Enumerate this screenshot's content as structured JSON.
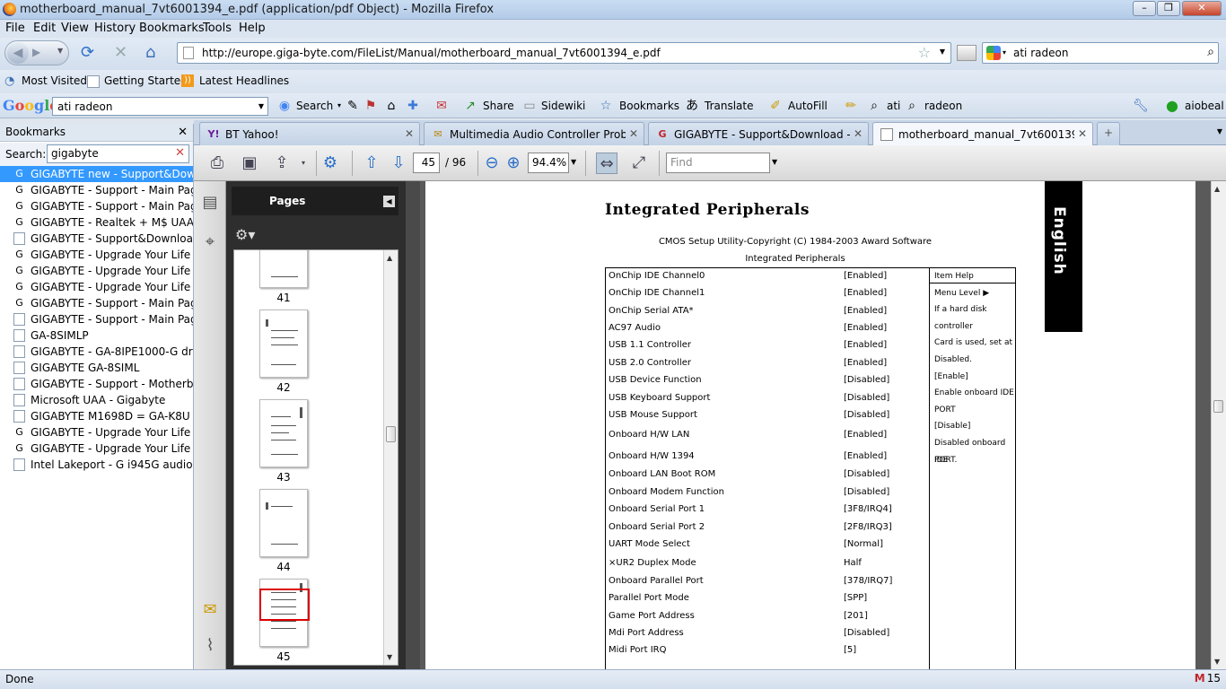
{
  "window": {
    "title": "motherboard_manual_7vt6001394_e.pdf (application/pdf Object) - Mozilla Firefox"
  },
  "menu": [
    "File",
    "Edit",
    "View",
    "History",
    "Bookmarks",
    "Tools",
    "Help"
  ],
  "nav": {
    "url": "http://europe.giga-byte.com/FileList/Manual/motherboard_manual_7vt6001394_e.pdf",
    "search_value": "ati radeon"
  },
  "bookmarks_toolbar": [
    "Most Visited",
    "Getting Started",
    "Latest Headlines"
  ],
  "google_toolbar": {
    "logo": "Google",
    "query": "ati radeon",
    "items": [
      "Search",
      "Share",
      "Sidewiki",
      "Bookmarks",
      "Translate",
      "AutoFill",
      "ati",
      "radeon"
    ],
    "account": "aiobeal"
  },
  "tabs": [
    {
      "label": "BT Yahoo!",
      "icon": "yahoo-icon"
    },
    {
      "label": "Multimedia Audio Controller Proble...",
      "icon": "forum-icon"
    },
    {
      "label": "GIGABYTE - Support&Download - ...",
      "icon": "gigabyte-icon"
    },
    {
      "label": "motherboard_manual_7vt600139...",
      "icon": "page-icon"
    }
  ],
  "sidebar": {
    "title": "Bookmarks",
    "search_label": "Search:",
    "search_value": "gigabyte",
    "items": [
      {
        "label": "GIGABYTE new - Support&Dow...",
        "icon": "gigabyte",
        "selected": true
      },
      {
        "label": "GIGABYTE - Support - Main Page",
        "icon": "gigabyte"
      },
      {
        "label": "GIGABYTE - Support - Main Page",
        "icon": "gigabyte"
      },
      {
        "label": "GIGABYTE - Realtek + M$ UAA",
        "icon": "gigabyte"
      },
      {
        "label": "GIGABYTE - Support&Download...",
        "icon": "page"
      },
      {
        "label": "GIGABYTE - Upgrade Your Life",
        "icon": "gigabyte"
      },
      {
        "label": "GIGABYTE - Upgrade Your Life",
        "icon": "gigabyte"
      },
      {
        "label": "GIGABYTE - Upgrade Your Life",
        "icon": "gigabyte"
      },
      {
        "label": "GIGABYTE - Support - Main Page",
        "icon": "gigabyte"
      },
      {
        "label": "GIGABYTE - Support - Main Page",
        "icon": "page"
      },
      {
        "label": "GA-8SIMLP",
        "icon": "page"
      },
      {
        "label": "GIGABYTE - GA-8IPE1000-G driv...",
        "icon": "page"
      },
      {
        "label": "GIGABYTE GA-8SIML",
        "icon": "page"
      },
      {
        "label": "GIGABYTE - Support - Motherbo...",
        "icon": "page"
      },
      {
        "label": "Microsoft UAA - Gigabyte",
        "icon": "page"
      },
      {
        "label": "GIGABYTE M1698D = GA-K8U",
        "icon": "page"
      },
      {
        "label": "GIGABYTE - Upgrade Your Life",
        "icon": "gigabyte"
      },
      {
        "label": "GIGABYTE - Upgrade Your Life",
        "icon": "gigabyte"
      },
      {
        "label": "Intel Lakeport - G i945G audio fr...",
        "icon": "page"
      }
    ]
  },
  "pdf_toolbar": {
    "page_current": "45",
    "page_total": "/ 96",
    "zoom": "94.4%",
    "find_placeholder": "Find"
  },
  "pages_panel": {
    "title": "Pages",
    "thumbnails": [
      "41",
      "42",
      "43",
      "44",
      "45"
    ],
    "current": "45"
  },
  "document": {
    "title": "Integrated  Peripherals",
    "caption1": "CMOS Setup Utility-Copyright (C) 1984-2003 Award Software",
    "caption2": "Integrated Peripherals",
    "side_tab": "English",
    "rows": [
      {
        "k": "OnChip IDE Channel0",
        "v": "[Enabled]"
      },
      {
        "k": "OnChip IDE Channel1",
        "v": "[Enabled]"
      },
      {
        "k": "OnChip Serial ATA*",
        "v": "[Enabled]"
      },
      {
        "k": "AC97 Audio",
        "v": "[Enabled]"
      },
      {
        "k": "USB 1.1 Controller",
        "v": "[Enabled]"
      },
      {
        "k": "USB 2.0 Controller",
        "v": "[Enabled]"
      },
      {
        "k": "USB Device  Function",
        "v": "[Disabled]"
      },
      {
        "k": "USB Keyboard Support",
        "v": "[Disabled]"
      },
      {
        "k": "USB Mouse Support",
        "v": "[Disabled]"
      },
      {
        "k": "Onboard H/W LAN",
        "v": "[Enabled]"
      },
      {
        "k": "Onboard H/W 1394",
        "v": "[Enabled]"
      },
      {
        "k": "Onboard LAN Boot ROM",
        "v": "[Disabled]"
      },
      {
        "k": "Onboard Modem Function",
        "v": "[Disabled]"
      },
      {
        "k": "Onboard Serial Port 1",
        "v": "[3F8/IRQ4]"
      },
      {
        "k": "Onboard Serial Port 2",
        "v": "[2F8/IRQ3]"
      },
      {
        "k": "UART Mode Select",
        "v": "[Normal]"
      },
      {
        "k": "×UR2 Duplex Mode",
        "v": "Half"
      },
      {
        "k": "Onboard Parallel Port",
        "v": "[378/IRQ7]"
      },
      {
        "k": "Parallel Port Mode",
        "v": "[SPP]"
      },
      {
        "k": "Game Port Address",
        "v": "[201]"
      },
      {
        "k": "Mdi Port Address",
        "v": "[Disabled]"
      },
      {
        "k": "Midi Port IRQ",
        "v": "[5]"
      }
    ],
    "help": [
      "Item Help",
      "Menu Level ▶",
      "If a hard disk",
      "controller",
      "Card is used, set at",
      "Disabled.",
      "[Enable]",
      "Enable onboard IDE",
      "PORT",
      "[Disable]",
      "Disabled onboard IDE",
      "PORT."
    ]
  },
  "status": {
    "text": "Done",
    "mail_count": "15"
  }
}
